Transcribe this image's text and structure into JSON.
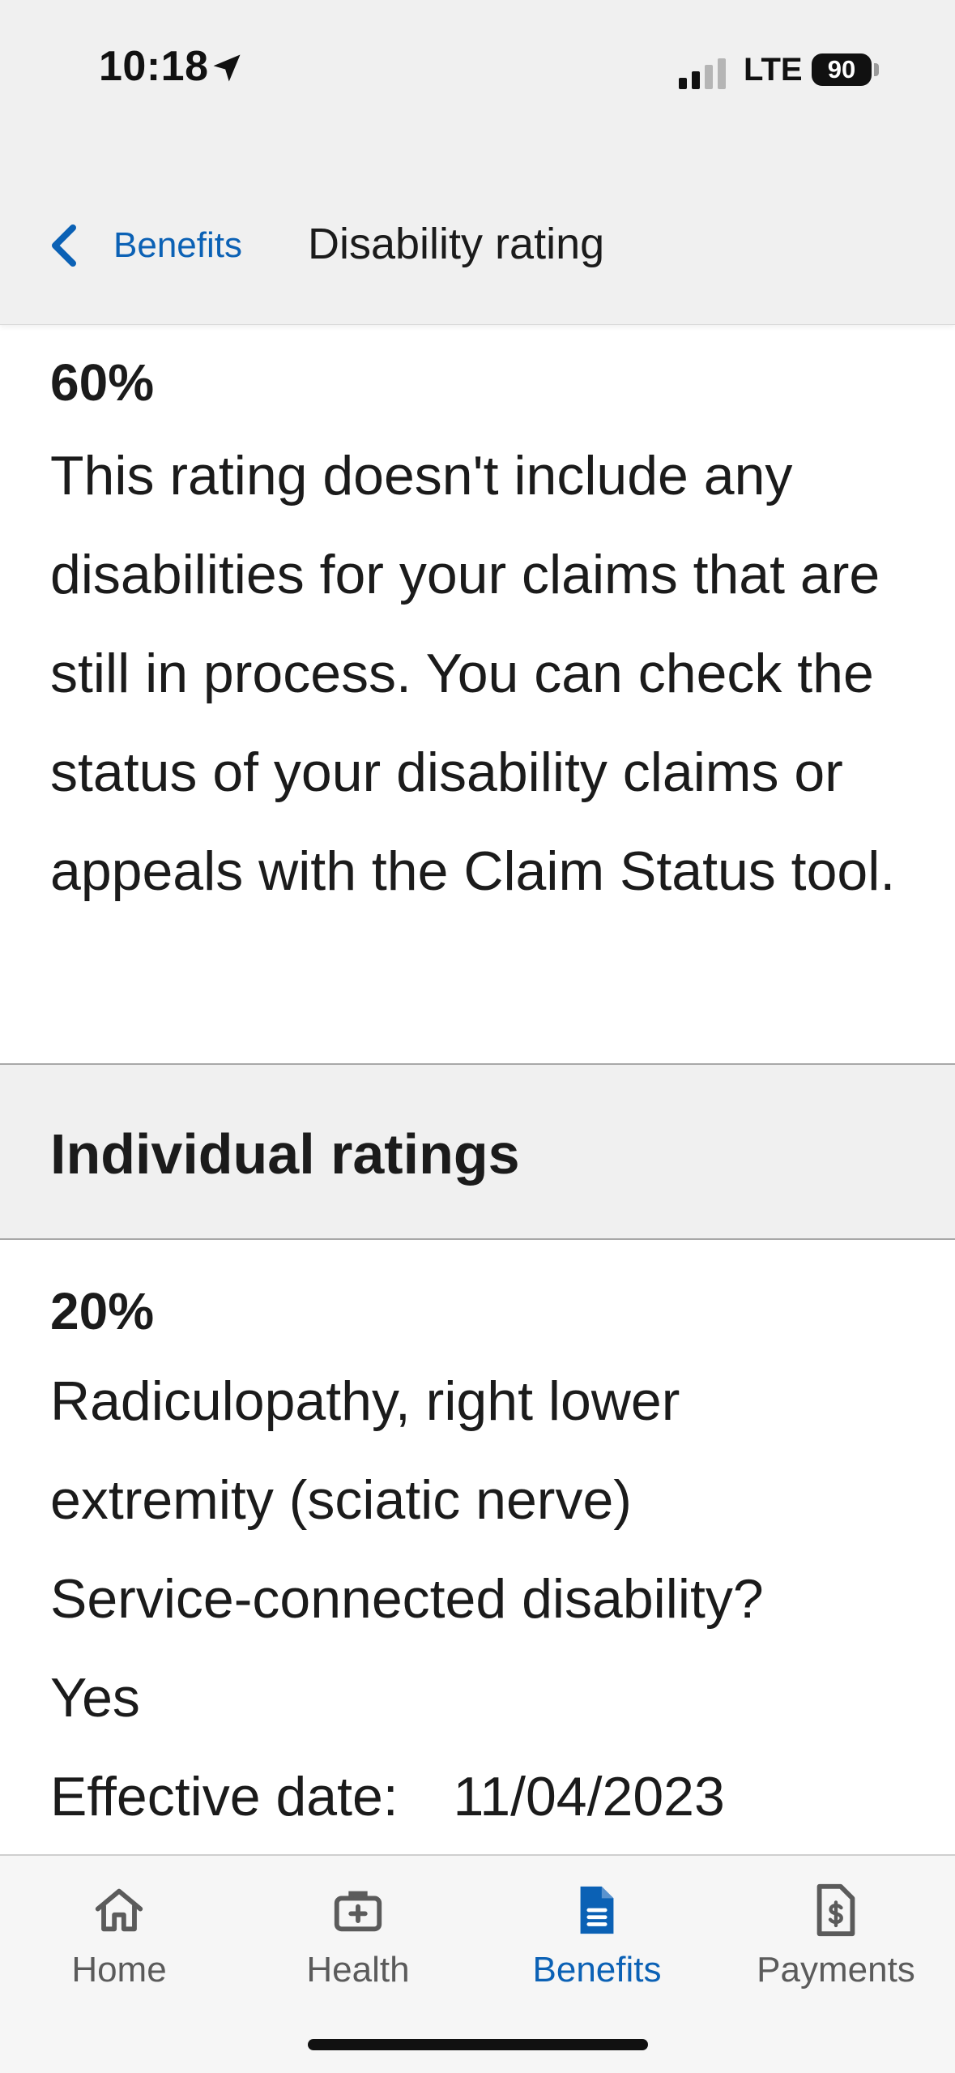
{
  "status_bar": {
    "time": "10:18",
    "network": "LTE",
    "battery": "90"
  },
  "nav": {
    "back_label": "Benefits",
    "title": "Disability rating"
  },
  "combined_rating": {
    "percent": "60%",
    "note": "This rating doesn't include any disabilities for your claims that are still in process. You can check the status of your disability claims or appeals with the Claim Status tool."
  },
  "individual_ratings": {
    "title": "Individual ratings",
    "items": [
      {
        "percent": "20%",
        "diagnosis": "Radiculopathy, right lower extremity (sciatic nerve)",
        "service_connected_label": "Service-connected disability?",
        "service_connected_value": "Yes",
        "effective_date_label": "Effective date:",
        "effective_date": "11/04/2023"
      }
    ]
  },
  "tab_bar": {
    "active_color": "#0b61b5",
    "inactive_color": "#5b5b5b",
    "tabs": [
      {
        "label": "Home",
        "icon": "home-icon"
      },
      {
        "label": "Health",
        "icon": "medical-kit-icon"
      },
      {
        "label": "Benefits",
        "icon": "document-icon",
        "active": true
      },
      {
        "label": "Payments",
        "icon": "payment-document-icon"
      }
    ]
  }
}
